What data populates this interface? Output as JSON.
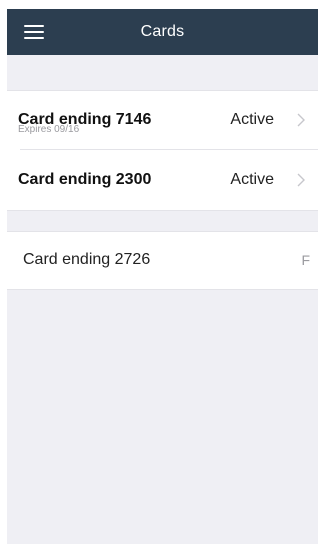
{
  "header": {
    "title": "Cards",
    "menu_icon": "hamburger-menu-icon",
    "background_color": "#2c3e50"
  },
  "cards": [
    {
      "label": "Card ending 7146",
      "subtitle": "Expires 09/16",
      "status": "Active",
      "chevron_icon": "chevron-right-icon"
    },
    {
      "label": "Card ending 2300",
      "status": "Active",
      "chevron_icon": "chevron-right-icon"
    }
  ],
  "other_cards": [
    {
      "label": "Card ending 2726",
      "trailing": "F"
    }
  ],
  "colors": {
    "background": "#efeff4",
    "row": "#ffffff",
    "separator": "#e3e3e8",
    "secondary_text": "#9b9ba0"
  }
}
